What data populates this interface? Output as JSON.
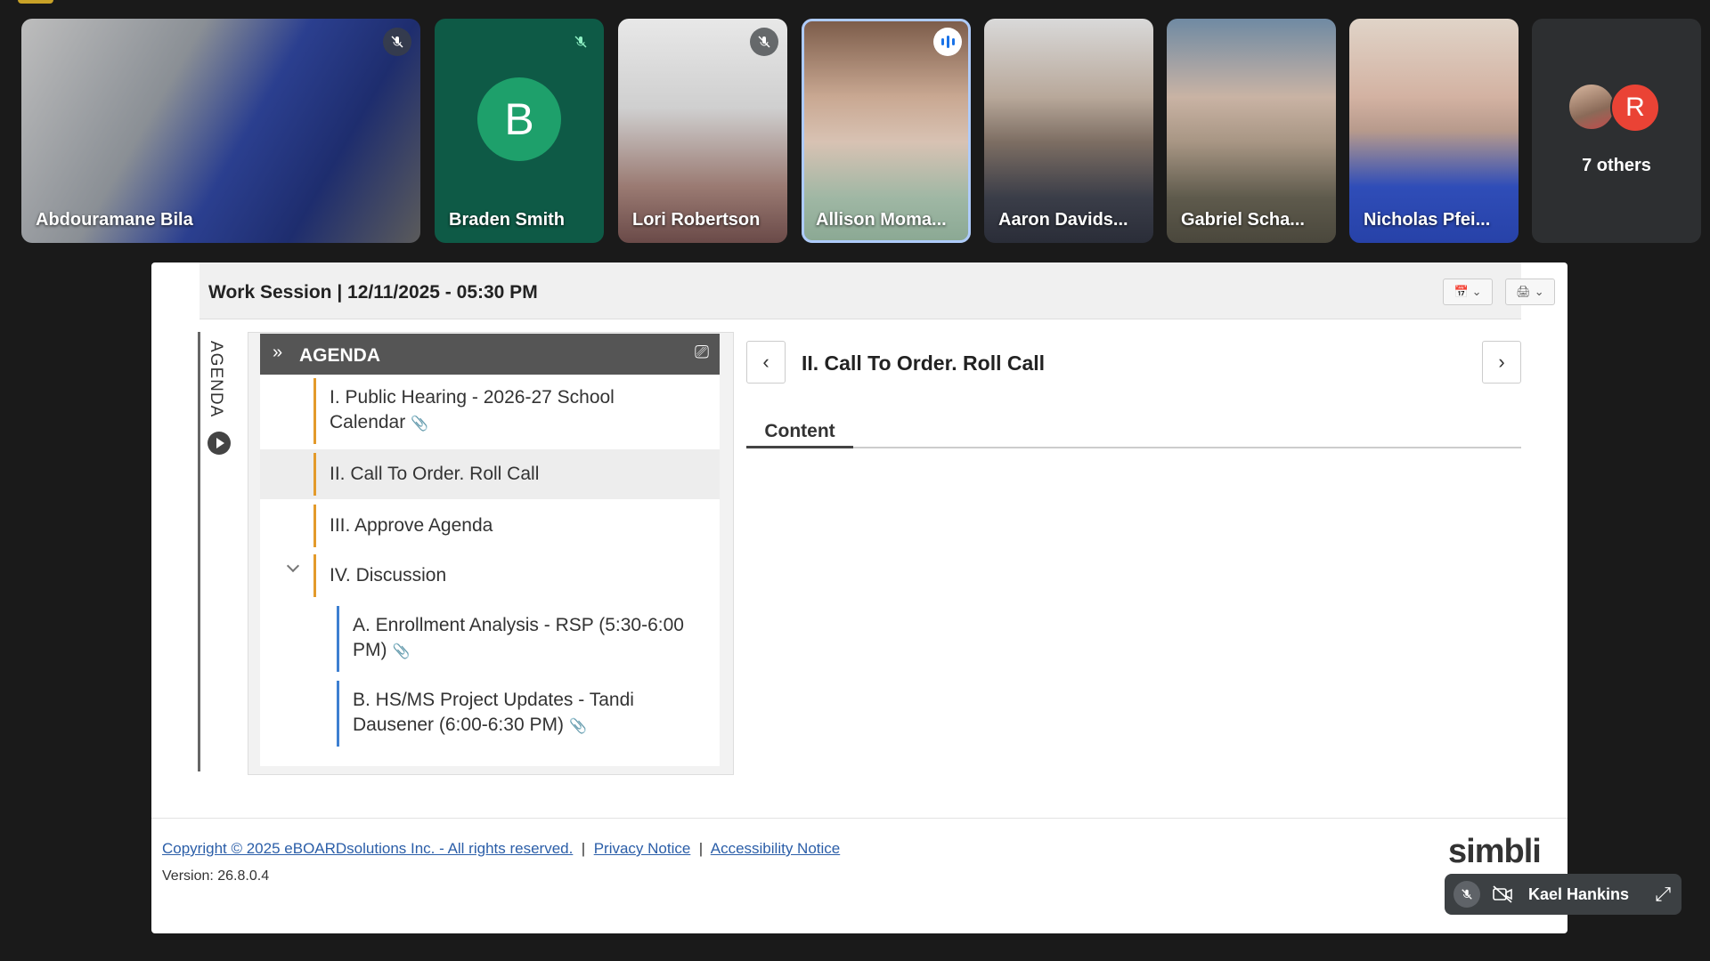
{
  "participants": [
    {
      "name": "Abdouramane Bila",
      "muted": true
    },
    {
      "name": "Braden Smith",
      "muted": true,
      "initial": "B"
    },
    {
      "name": "Lori Robertson",
      "muted": true
    },
    {
      "name": "Allison Moma...",
      "speaking": true
    },
    {
      "name": "Aaron Davids..."
    },
    {
      "name": "Gabriel Scha..."
    },
    {
      "name": "Nicholas Pfei..."
    }
  ],
  "others": {
    "label": "7 others",
    "avatar_initial": "R"
  },
  "meeting": {
    "title": "Work Session | 12/11/2025 - 05:30 PM"
  },
  "agenda": {
    "vertical_label": "AGENDA",
    "header": "AGENDA",
    "items": [
      {
        "line1": "I. Public Hearing - 2026-27 School",
        "line2": "Calendar"
      },
      {
        "line1": "II. Call To Order. Roll Call"
      },
      {
        "line1": "III. Approve Agenda"
      },
      {
        "line1": "IV. Discussion"
      },
      {
        "line1": "A. Enrollment Analysis - RSP (5:30-6:00",
        "line2": "PM)"
      },
      {
        "line1": "B. HS/MS Project Updates - Tandi",
        "line2": "Dausener (6:00-6:30 PM)"
      }
    ],
    "selected_index": 1
  },
  "detail": {
    "title": "II. Call To Order. Roll Call",
    "tab": "Content"
  },
  "footer": {
    "copyright": "Copyright © 2025 eBOARDsolutions Inc. - All rights reserved.",
    "privacy": "Privacy Notice",
    "accessibility": "Accessibility Notice",
    "version": "Version: 26.8.0.4",
    "brand": "simbli"
  },
  "self_view": {
    "name": "Kael Hankins"
  },
  "icons": {
    "mic_off": "mic-off-icon",
    "speaking": "audio-level-icon",
    "calendar": "calendar-icon",
    "print": "print-icon",
    "chevron_left": "chevron-left-icon",
    "chevron_right": "chevron-right-icon",
    "expand": "expand-icon",
    "cam_off": "camera-off-icon"
  },
  "colors": {
    "accent_orange": "#e39a2b",
    "accent_blue": "#3d7fd1",
    "meet_green": "#1ea06b",
    "meet_red": "#ea4335"
  }
}
